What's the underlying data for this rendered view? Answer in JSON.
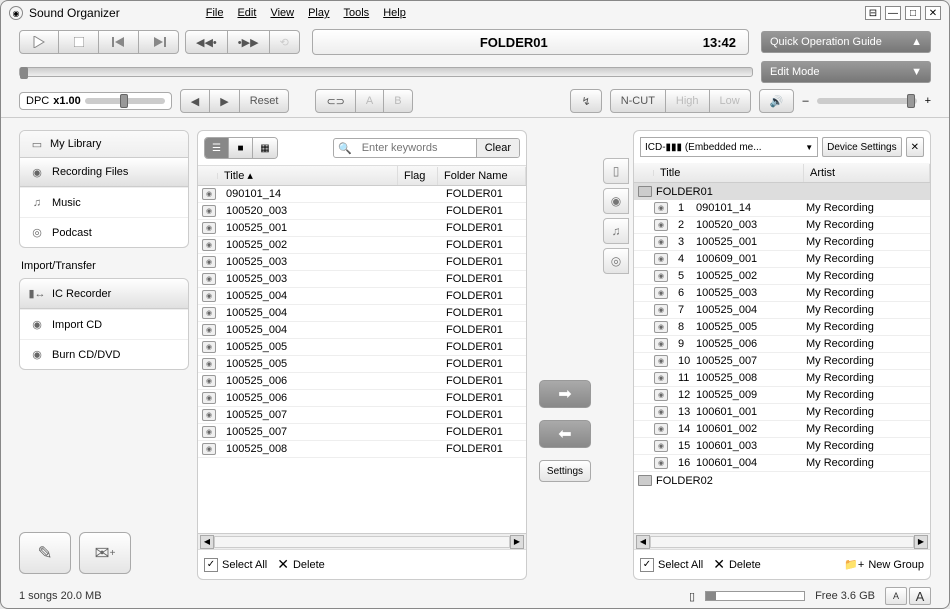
{
  "app": {
    "title": "Sound Organizer"
  },
  "menu": [
    "File",
    "Edit",
    "View",
    "Play",
    "Tools",
    "Help"
  ],
  "nowPlaying": {
    "title": "FOLDER01",
    "time": "13:42"
  },
  "sideButtons": {
    "guide": "Quick Operation Guide",
    "edit": "Edit Mode"
  },
  "dpc": {
    "label": "DPC",
    "value": "x1.00",
    "reset": "Reset"
  },
  "repeat": {
    "a": "A",
    "b": "B"
  },
  "ncut": {
    "label": "N-CUT",
    "high": "High",
    "low": "Low"
  },
  "nav": {
    "library": "My Library",
    "items": [
      {
        "label": "Recording Files"
      },
      {
        "label": "Music"
      },
      {
        "label": "Podcast"
      }
    ],
    "importLabel": "Import/Transfer",
    "importItems": [
      {
        "label": "IC Recorder"
      },
      {
        "label": "Import CD"
      },
      {
        "label": "Burn CD/DVD"
      }
    ]
  },
  "search": {
    "placeholder": "Enter keywords",
    "clear": "Clear"
  },
  "leftTable": {
    "cols": {
      "title": "Title",
      "flag": "Flag",
      "folder": "Folder Name"
    },
    "rows": [
      {
        "title": "090101_14",
        "folder": "FOLDER01"
      },
      {
        "title": "100520_003",
        "folder": "FOLDER01"
      },
      {
        "title": "100525_001",
        "folder": "FOLDER01"
      },
      {
        "title": "100525_002",
        "folder": "FOLDER01"
      },
      {
        "title": "100525_003",
        "folder": "FOLDER01"
      },
      {
        "title": "100525_003",
        "folder": "FOLDER01"
      },
      {
        "title": "100525_004",
        "folder": "FOLDER01"
      },
      {
        "title": "100525_004",
        "folder": "FOLDER01"
      },
      {
        "title": "100525_004",
        "folder": "FOLDER01"
      },
      {
        "title": "100525_005",
        "folder": "FOLDER01"
      },
      {
        "title": "100525_005",
        "folder": "FOLDER01"
      },
      {
        "title": "100525_006",
        "folder": "FOLDER01"
      },
      {
        "title": "100525_006",
        "folder": "FOLDER01"
      },
      {
        "title": "100525_007",
        "folder": "FOLDER01"
      },
      {
        "title": "100525_007",
        "folder": "FOLDER01"
      },
      {
        "title": "100525_008",
        "folder": "FOLDER01"
      }
    ]
  },
  "rightPanel": {
    "device": "ICD-▮▮▮ (Embedded me...",
    "deviceSettings": "Device Settings",
    "cols": {
      "title": "Title",
      "artist": "Artist"
    },
    "folder1": "FOLDER01",
    "folder2": "FOLDER02",
    "rows": [
      {
        "n": "1",
        "title": "090101_14",
        "artist": "My Recording"
      },
      {
        "n": "2",
        "title": "100520_003",
        "artist": "My Recording"
      },
      {
        "n": "3",
        "title": "100525_001",
        "artist": "My Recording"
      },
      {
        "n": "4",
        "title": "100609_001",
        "artist": "My Recording"
      },
      {
        "n": "5",
        "title": "100525_002",
        "artist": "My Recording"
      },
      {
        "n": "6",
        "title": "100525_003",
        "artist": "My Recording"
      },
      {
        "n": "7",
        "title": "100525_004",
        "artist": "My Recording"
      },
      {
        "n": "8",
        "title": "100525_005",
        "artist": "My Recording"
      },
      {
        "n": "9",
        "title": "100525_006",
        "artist": "My Recording"
      },
      {
        "n": "10",
        "title": "100525_007",
        "artist": "My Recording"
      },
      {
        "n": "11",
        "title": "100525_008",
        "artist": "My Recording"
      },
      {
        "n": "12",
        "title": "100525_009",
        "artist": "My Recording"
      },
      {
        "n": "13",
        "title": "100601_001",
        "artist": "My Recording"
      },
      {
        "n": "14",
        "title": "100601_002",
        "artist": "My Recording"
      },
      {
        "n": "15",
        "title": "100601_003",
        "artist": "My Recording"
      },
      {
        "n": "16",
        "title": "100601_004",
        "artist": "My Recording"
      }
    ]
  },
  "footer": {
    "selectAll": "Select All",
    "delete": "Delete",
    "newGroup": "New Group"
  },
  "xfer": {
    "settings": "Settings"
  },
  "status": {
    "songs": "1 songs 20.0 MB",
    "free": "Free 3.6 GB"
  },
  "fontBtns": {
    "small": "A",
    "large": "A"
  }
}
